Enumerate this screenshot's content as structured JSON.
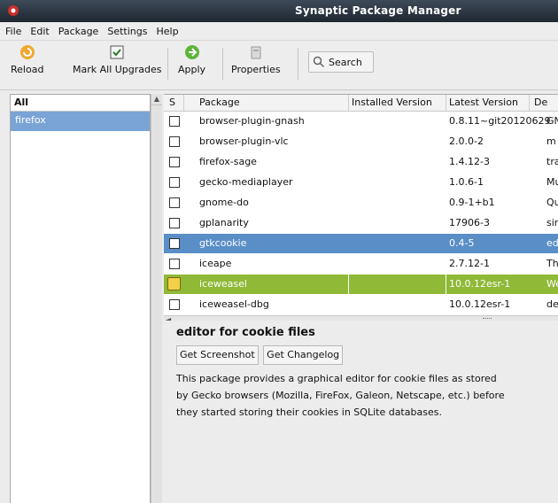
{
  "window": {
    "title": "Synaptic Package Manager"
  },
  "menu": [
    "File",
    "Edit",
    "Package",
    "Settings",
    "Help"
  ],
  "toolbar": {
    "reload": "Reload",
    "mark_all": "Mark All Upgrades",
    "apply": "Apply",
    "properties": "Properties",
    "search": "Search"
  },
  "filters": {
    "header": "All",
    "items": [
      "firefox"
    ]
  },
  "list": {
    "columns": [
      "S",
      "Package",
      "Installed Version",
      "Latest Version",
      "De"
    ],
    "rows": [
      {
        "name": "browser-plugin-gnash",
        "installed": "",
        "latest": "0.8.11~git20120629",
        "desc": "GN"
      },
      {
        "name": "browser-plugin-vlc",
        "installed": "",
        "latest": "2.0.0-2",
        "desc": "m"
      },
      {
        "name": "firefox-sage",
        "installed": "",
        "latest": "1.4.12-3",
        "desc": "tra"
      },
      {
        "name": "gecko-mediaplayer",
        "installed": "",
        "latest": "1.0.6-1",
        "desc": "Mu"
      },
      {
        "name": "gnome-do",
        "installed": "",
        "latest": "0.9-1+b1",
        "desc": "Qu"
      },
      {
        "name": "gplanarity",
        "installed": "",
        "latest": "17906-3",
        "desc": "sir"
      },
      {
        "name": "gtkcookie",
        "installed": "",
        "latest": "0.4-5",
        "desc": "ed"
      },
      {
        "name": "iceape",
        "installed": "",
        "latest": "2.7.12-1",
        "desc": "Th"
      },
      {
        "name": "iceweasel",
        "installed": "",
        "latest": "10.0.12esr-1",
        "desc": "We"
      },
      {
        "name": "iceweasel-dbg",
        "installed": "",
        "latest": "10.0.12esr-1",
        "desc": "de"
      }
    ]
  },
  "detail": {
    "title": "editor for cookie files",
    "screenshot_btn": "Get Screenshot",
    "changelog_btn": "Get Changelog",
    "desc_lines": [
      "This package provides a graphical editor for cookie files as stored",
      "by Gecko browsers (Mozilla, FireFox, Galeon, Netscape, etc.) before",
      "they started storing their cookies in SQLite databases."
    ]
  }
}
